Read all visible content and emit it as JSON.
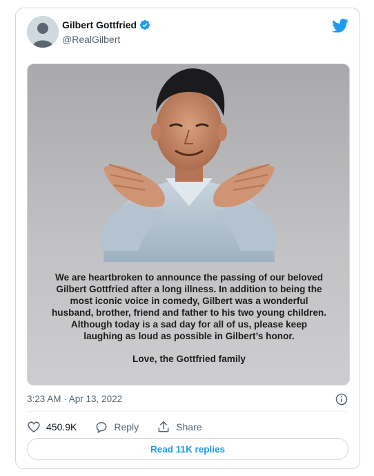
{
  "author": {
    "name": "Gilbert Gottfried",
    "handle": "@RealGilbert",
    "verified": true
  },
  "statement": {
    "lines": [
      "We are heartbroken to announce the passing of our beloved",
      "Gilbert Gottfried after a long illness.  In addition to being the",
      "most iconic voice in comedy, Gilbert was a wonderful",
      "husband, brother, friend and father to his two young children.",
      "Although today is a sad day for all of us, please keep",
      "laughing as loud as possible in Gilbert’s honor."
    ],
    "signature": "Love, the Gottfried family"
  },
  "timestamp": "3:23 AM · Apr 13, 2022",
  "actions": {
    "like_count": "450.9K",
    "reply_label": "Reply",
    "share_label": "Share"
  },
  "read_replies_label": "Read 11K replies",
  "colors": {
    "accent": "#1d9bf0",
    "text": "#0f1419",
    "muted": "#536471",
    "border": "#cfd9de"
  },
  "icons": [
    "twitter-logo-icon",
    "verified-badge-icon",
    "info-icon",
    "heart-icon",
    "reply-icon",
    "share-icon"
  ]
}
